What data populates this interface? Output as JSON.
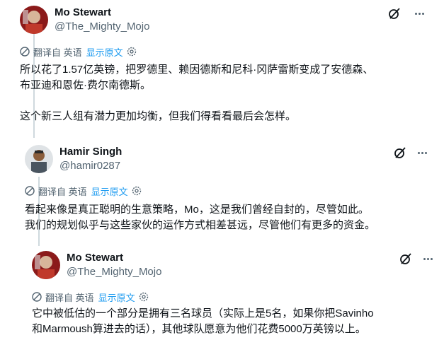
{
  "translate_bar": {
    "translated_from": "翻译自 英语",
    "show_original": "显示原文"
  },
  "tweets": [
    {
      "display_name": "Mo Stewart",
      "handle": "@The_Mighty_Mojo",
      "lines": [
        "所以花了1.57亿英镑，把罗德里、赖因德斯和尼科·冈萨雷斯变成了安德森、",
        "布亚迪和恩佐·费尔南德斯。",
        "",
        "这个新三人组有潜力更加均衡，但我们得看看最后会怎样。"
      ]
    },
    {
      "display_name": "Hamir Singh",
      "handle": "@hamir0287",
      "lines": [
        "看起来像是真正聪明的生意策略，Mo，这是我们曾经自封的，尽管如此。",
        "我们的规划似乎与这些家伙的运作方式相差甚远，尽管他们有更多的资金。"
      ]
    },
    {
      "display_name": "Mo Stewart",
      "handle": "@The_Mighty_Mojo",
      "lines": [
        "它中被低估的一个部分是拥有三名球员（实际上是5名，如果你把Savinho",
        "和Marmoush算进去的话），其他球队愿意为他们花费5000万英镑以上。"
      ]
    }
  ],
  "colors": {
    "text": "#0f1419",
    "secondary": "#536471",
    "link": "#1d9bf0",
    "thread_line": "#cfd9de"
  }
}
